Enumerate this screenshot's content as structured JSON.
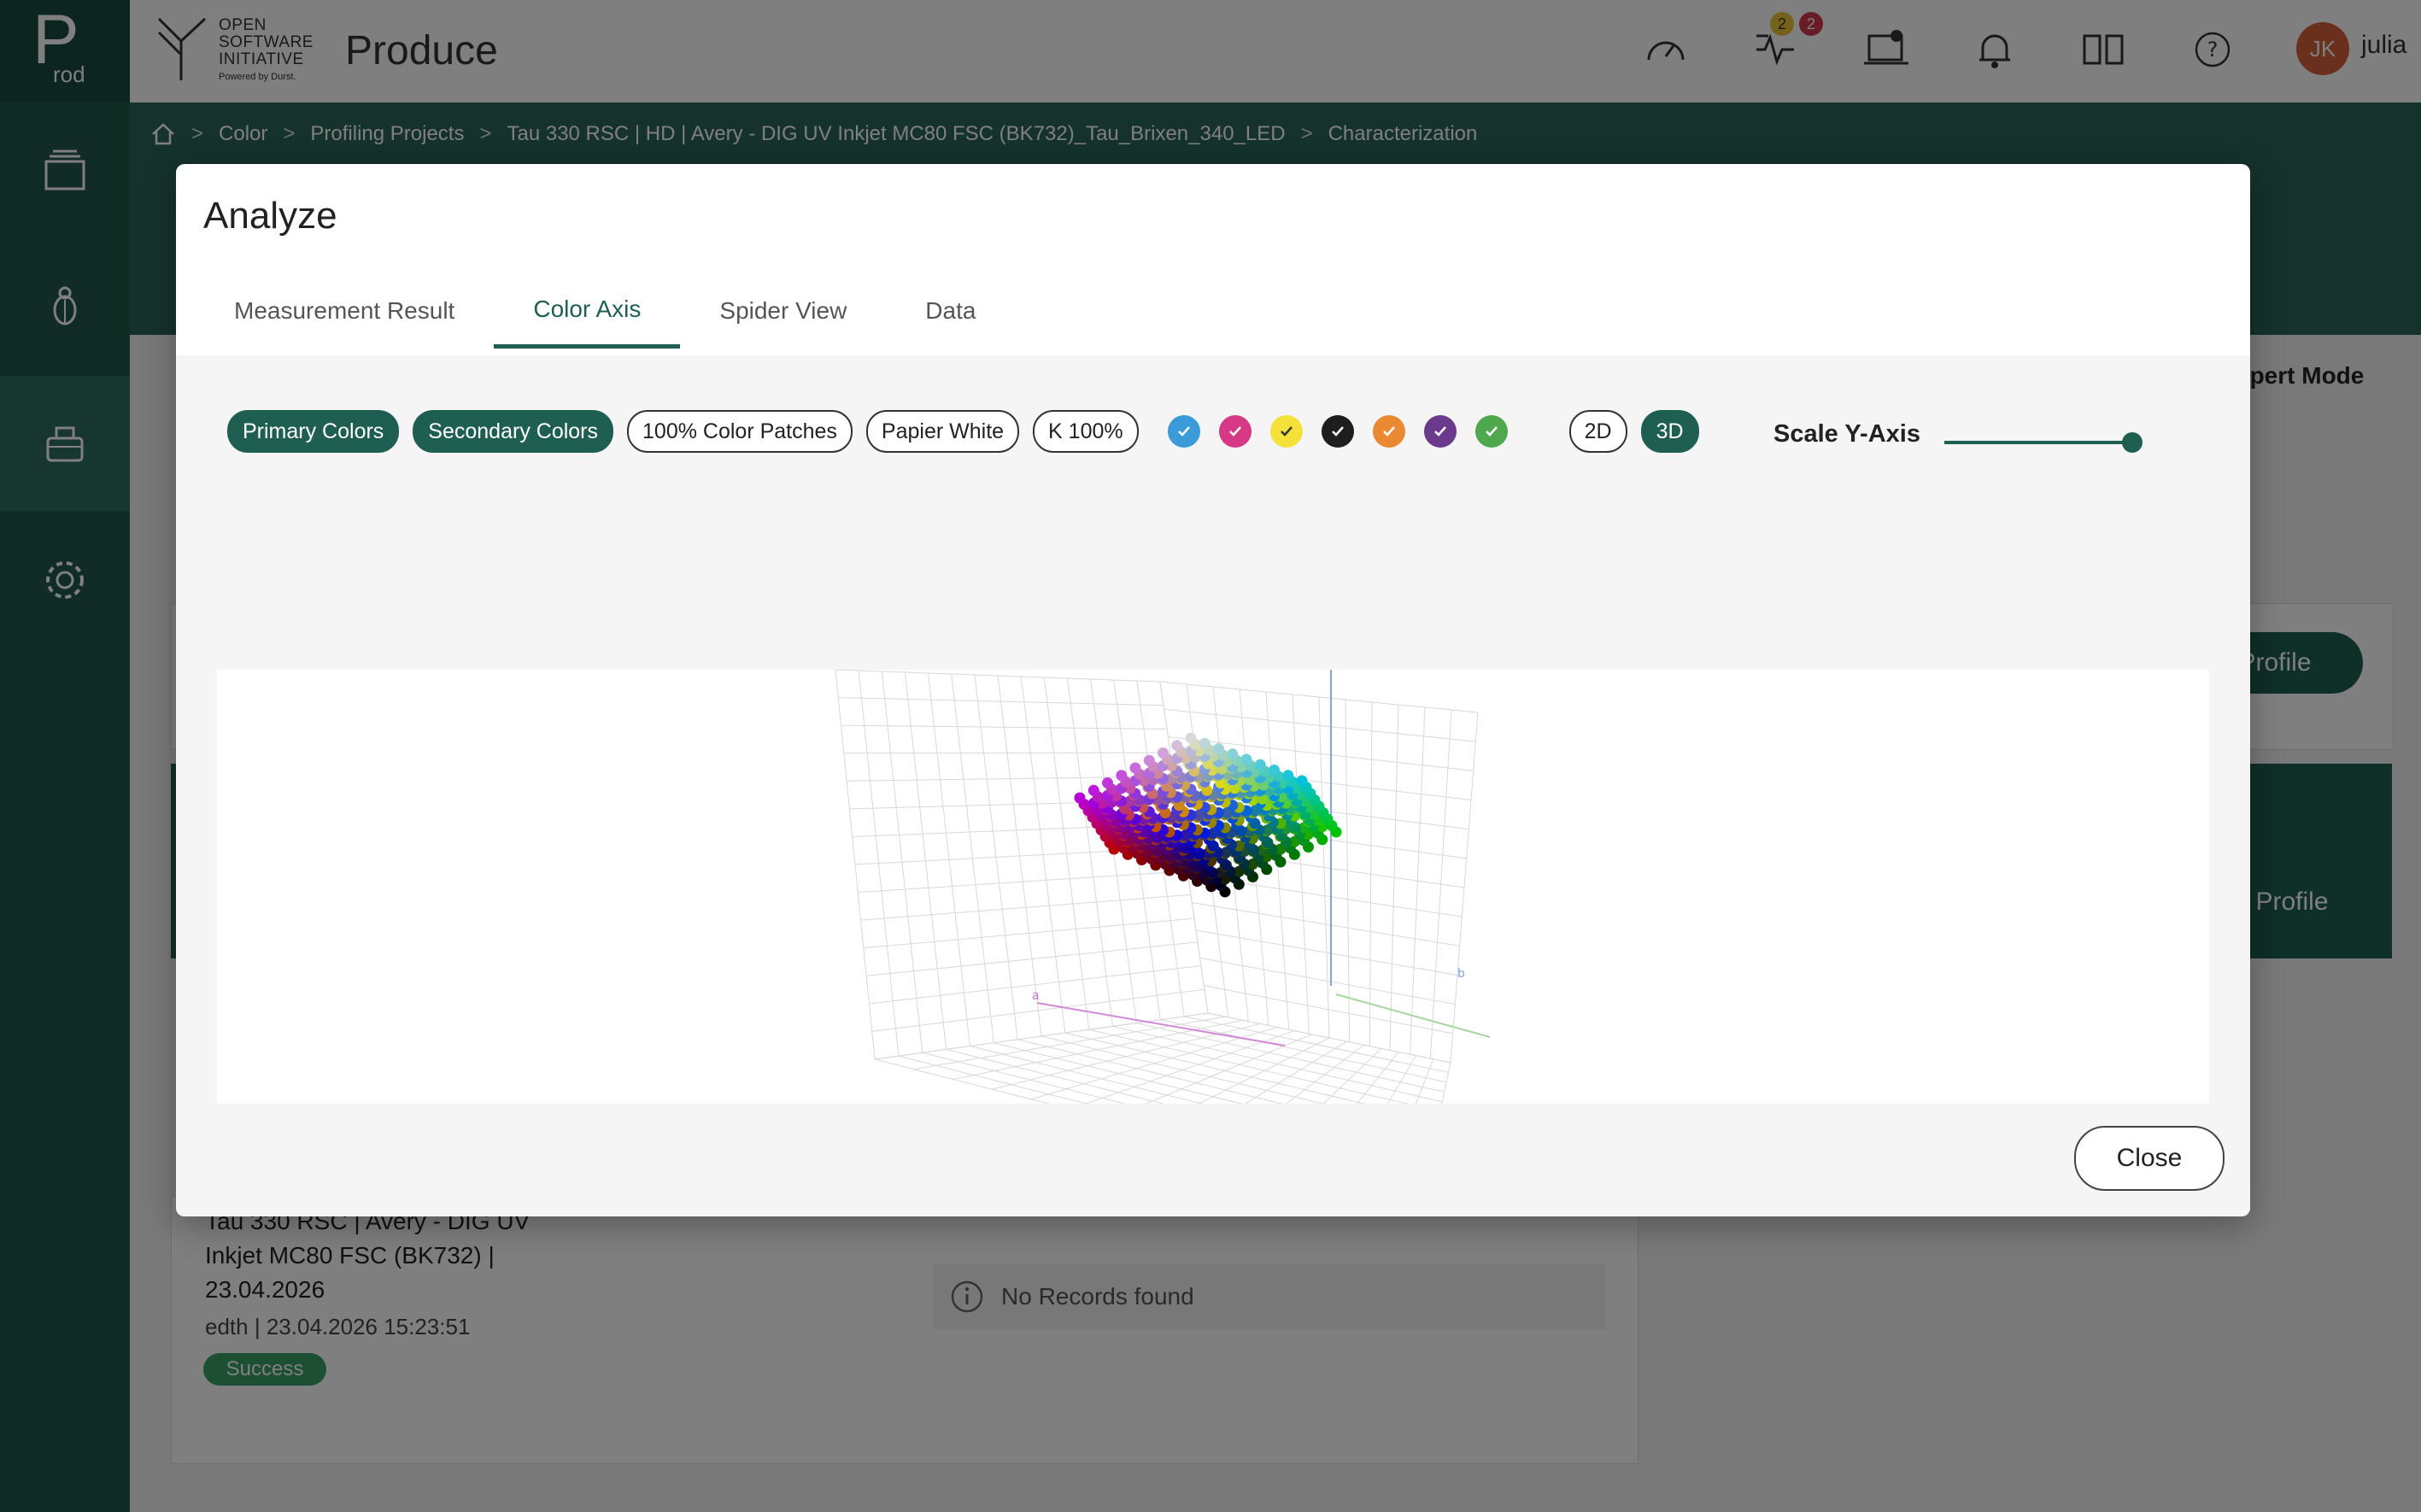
{
  "brand": {
    "letter": "P",
    "suffix": "rod"
  },
  "logo": {
    "line1": "OPEN",
    "line2": "SOFTWARE",
    "line3": "INITIATIVE",
    "sub": "Powered by Durst."
  },
  "header": {
    "app_title": "Produce",
    "badge_yellow": "2",
    "badge_red": "2",
    "avatar_initials": "JK",
    "username": "julia"
  },
  "breadcrumb": [
    "Color",
    "Profiling Projects",
    "Tau 330 RSC | HD | Avery - DIG UV Inkjet MC80 FSC (BK732)_Tau_Brixen_340_LED",
    "Characterization"
  ],
  "background": {
    "expert_mode": "xpert Mode",
    "profile_btn1": "Profile",
    "profile_btn2": "Profile",
    "list_item": {
      "title": "Tau 330 RSC | Avery - DIG UV Inkjet MC80 FSC (BK732) | 23.04.2026",
      "meta_user": "edth",
      "meta_sep": "|",
      "meta_time": "23.04.2026 15:23:51",
      "status": "Success"
    },
    "no_records": "No Records found"
  },
  "modal": {
    "title": "Analyze",
    "tabs": [
      {
        "label": "Measurement Result"
      },
      {
        "label": "Color Axis"
      },
      {
        "label": "Spider View"
      },
      {
        "label": "Data"
      }
    ],
    "active_tab": "Color Axis",
    "chips": [
      {
        "label": "Primary Colors",
        "on": true
      },
      {
        "label": "Secondary Colors",
        "on": true
      },
      {
        "label": "100% Color Patches",
        "on": false
      },
      {
        "label": "Papier White",
        "on": false
      },
      {
        "label": "K 100%",
        "on": false
      }
    ],
    "swatches": [
      {
        "name": "cyan",
        "color": "#3b9bd8"
      },
      {
        "name": "magenta",
        "color": "#d63a86"
      },
      {
        "name": "yellow",
        "color": "#f4e23a"
      },
      {
        "name": "black",
        "color": "#1e1e1e"
      },
      {
        "name": "orange",
        "color": "#e98a33"
      },
      {
        "name": "violet",
        "color": "#6a3a8c"
      },
      {
        "name": "green",
        "color": "#4fa84e"
      }
    ],
    "view_2d": "2D",
    "view_3d": "3D",
    "view_selected": "3D",
    "scale_label": "Scale Y-Axis",
    "scale_value": 1.0,
    "axis_label_a": "a",
    "axis_label_b": "b",
    "close_label": "Close"
  },
  "colors": {
    "brand_green": "#1f5f52",
    "sidebar": "#23564b",
    "band": "#2a6558"
  }
}
